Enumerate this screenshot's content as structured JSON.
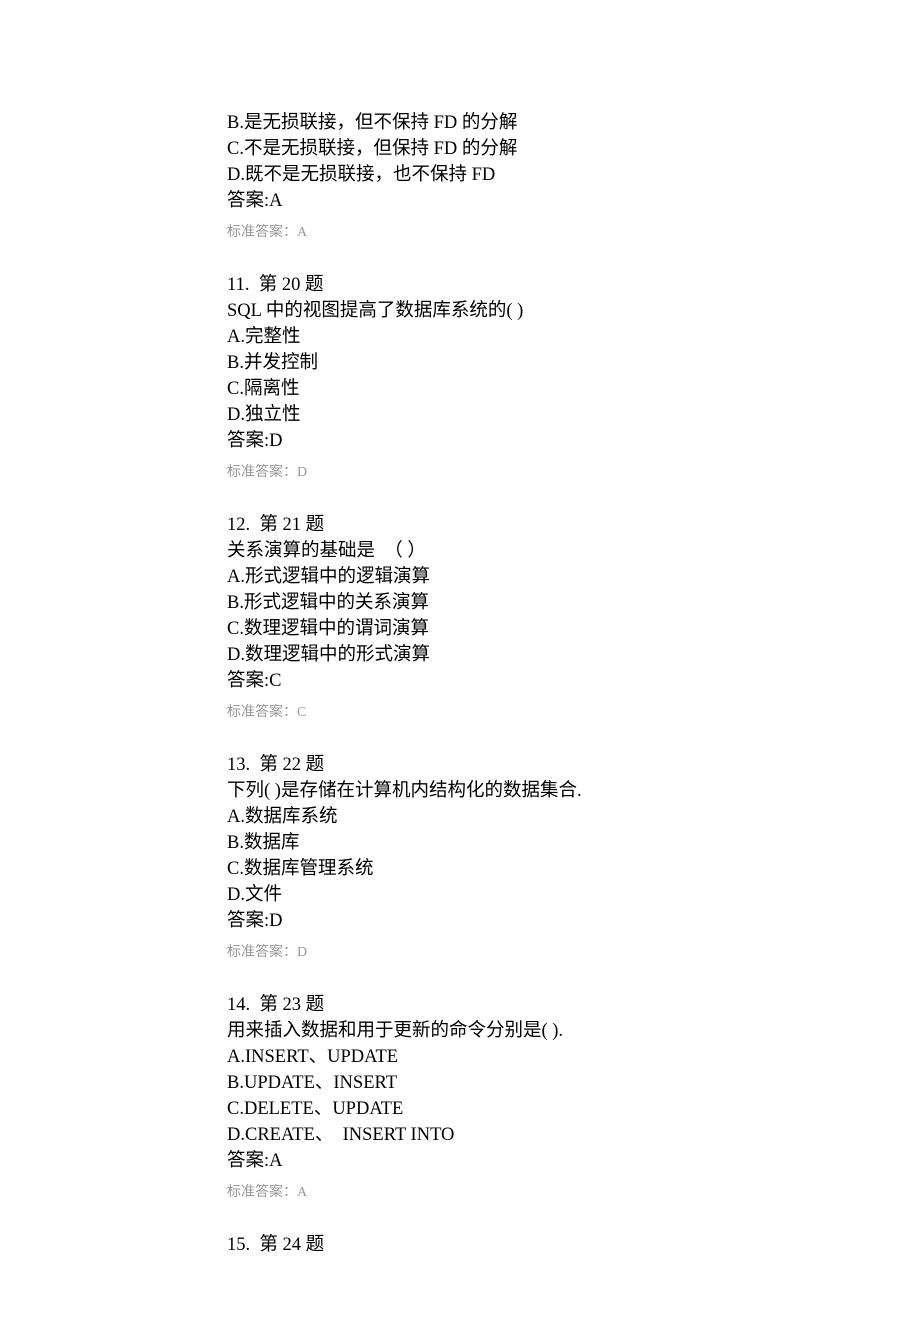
{
  "q10_tail": {
    "options": [
      "B.是无损联接，但不保持 FD 的分解",
      "C.不是无损联接，但保持 FD 的分解",
      "D.既不是无损联接，也不保持 FD"
    ],
    "answer": "答案:A",
    "std": "标准答案：A"
  },
  "q11": {
    "header": "11.  第 20 题",
    "stem": "SQL 中的视图提高了数据库系统的( )",
    "options": [
      "A.完整性",
      "B.并发控制",
      "C.隔离性",
      "D.独立性"
    ],
    "answer": "答案:D",
    "std": "标准答案：D"
  },
  "q12": {
    "header": "12.  第 21 题",
    "stem": "关系演算的基础是  （ ）",
    "options": [
      "A.形式逻辑中的逻辑演算",
      "B.形式逻辑中的关系演算",
      "C.数理逻辑中的谓词演算",
      "D.数理逻辑中的形式演算"
    ],
    "answer": "答案:C",
    "std": "标准答案：C"
  },
  "q13": {
    "header": "13.  第 22 题",
    "stem": "下列( )是存储在计算机内结构化的数据集合.",
    "options": [
      "A.数据库系统",
      "B.数据库",
      "C.数据库管理系统",
      "D.文件"
    ],
    "answer": "答案:D",
    "std": "标准答案：D"
  },
  "q14": {
    "header": "14.  第 23 题",
    "stem": "用来插入数据和用于更新的命令分别是( ).",
    "options": [
      "A.INSERT、UPDATE",
      "B.UPDATE、INSERT",
      "C.DELETE、UPDATE",
      "D.CREATE、  INSERT INTO"
    ],
    "answer": "答案:A",
    "std": "标准答案：A"
  },
  "q15": {
    "header": "15.  第 24 题"
  }
}
